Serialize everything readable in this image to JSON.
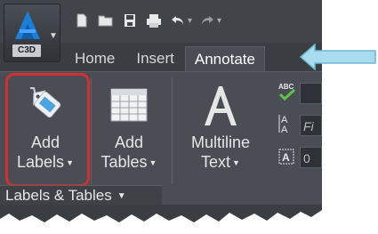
{
  "app": {
    "logo_caption": "C3D",
    "accent_color": "#1a7fd6"
  },
  "quick_access": {
    "icons": [
      "new-icon",
      "open-icon",
      "save-icon",
      "print-icon",
      "undo-icon",
      "redo-icon"
    ]
  },
  "tabs": [
    {
      "label": "Home",
      "active": false
    },
    {
      "label": "Insert",
      "active": false
    },
    {
      "label": "Annotate",
      "active": true
    }
  ],
  "ribbon": {
    "add_labels": {
      "line1": "Add",
      "line2": "Labels",
      "highlighted": true,
      "highlight_color": "#d32f2f"
    },
    "add_tables": {
      "line1": "Add",
      "line2": "Tables"
    },
    "multiline_text": {
      "line1": "Multiline",
      "line2": "Text"
    },
    "small_tools": [
      {
        "icon": "spell-check-icon",
        "field": ""
      },
      {
        "icon": "text-height-icon",
        "field": "Fi"
      },
      {
        "icon": "text-style-icon",
        "field": "0"
      }
    ],
    "panel_title": "Labels & Tables"
  },
  "callout": {
    "color": "#a9dcef",
    "icon": "arrow-left-icon"
  }
}
